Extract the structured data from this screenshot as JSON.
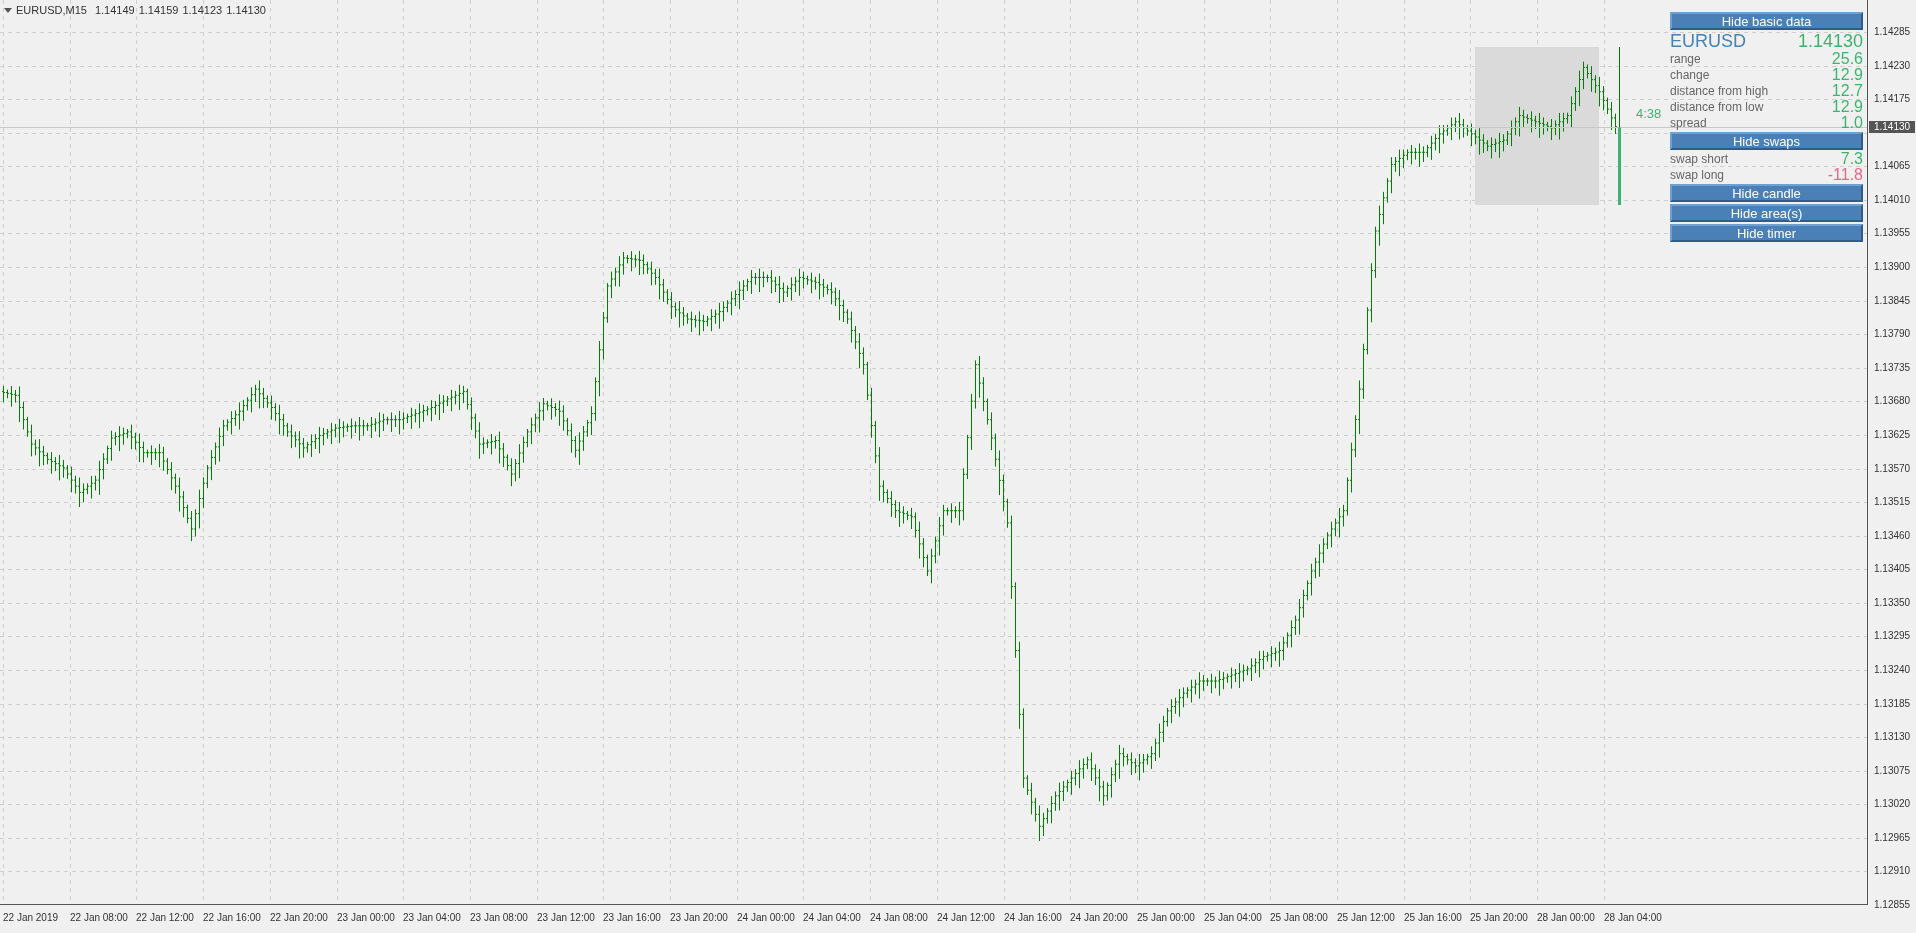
{
  "chart_header": {
    "symbol": "EURUSD,M15",
    "ohlc": [
      "1.14149",
      "1.14159",
      "1.14123",
      "1.14130"
    ]
  },
  "price_axis": {
    "labels": [
      "1.14285",
      "1.14230",
      "1.14175",
      "1.14065",
      "1.14010",
      "1.13955",
      "1.13900",
      "1.13845",
      "1.13790",
      "1.13735",
      "1.13680",
      "1.13625",
      "1.13570",
      "1.13515",
      "1.13460",
      "1.13405",
      "1.13350",
      "1.13295",
      "1.13240",
      "1.13185",
      "1.13130",
      "1.13075",
      "1.13020",
      "1.12965",
      "1.12910",
      "1.12855"
    ]
  },
  "time_axis": {
    "labels": [
      "22 Jan 2019",
      "22 Jan 08:00",
      "22 Jan 12:00",
      "22 Jan 16:00",
      "22 Jan 20:00",
      "23 Jan 00:00",
      "23 Jan 04:00",
      "23 Jan 08:00",
      "23 Jan 12:00",
      "23 Jan 16:00",
      "23 Jan 20:00",
      "24 Jan 00:00",
      "24 Jan 04:00",
      "24 Jan 08:00",
      "24 Jan 12:00",
      "24 Jan 16:00",
      "24 Jan 20:00",
      "25 Jan 00:00",
      "25 Jan 04:00",
      "25 Jan 08:00",
      "25 Jan 12:00",
      "25 Jan 16:00",
      "25 Jan 20:00",
      "28 Jan 00:00",
      "28 Jan 04:00"
    ]
  },
  "price_tag": "1.14130",
  "timer": "4:38",
  "panel": {
    "items": [
      {
        "kind": "button",
        "label": "Hide basic data"
      },
      {
        "kind": "title",
        "label": "EURUSD",
        "value": "1.14130",
        "color": "#3cb371"
      },
      {
        "kind": "row",
        "label": "range",
        "value": "25.6",
        "color": "#3cb371"
      },
      {
        "kind": "row",
        "label": "change",
        "value": "12.9",
        "color": "#3cb371"
      },
      {
        "kind": "row",
        "label": "distance from high",
        "value": "12.7",
        "color": "#3cb371"
      },
      {
        "kind": "row",
        "label": "distance from low",
        "value": "12.9",
        "color": "#3cb371"
      },
      {
        "kind": "row",
        "label": "spread",
        "value": "1.0",
        "color": "#3cb371"
      },
      {
        "kind": "button",
        "label": "Hide swaps"
      },
      {
        "kind": "row",
        "label": "swap short",
        "value": "7.3",
        "color": "#3cb371"
      },
      {
        "kind": "row",
        "label": "swap long",
        "value": "-11.8",
        "color": "#e8668a"
      },
      {
        "kind": "button",
        "label": "Hide candle"
      },
      {
        "kind": "button",
        "label": "Hide area(s)"
      },
      {
        "kind": "button",
        "label": "Hide timer"
      }
    ]
  }
}
